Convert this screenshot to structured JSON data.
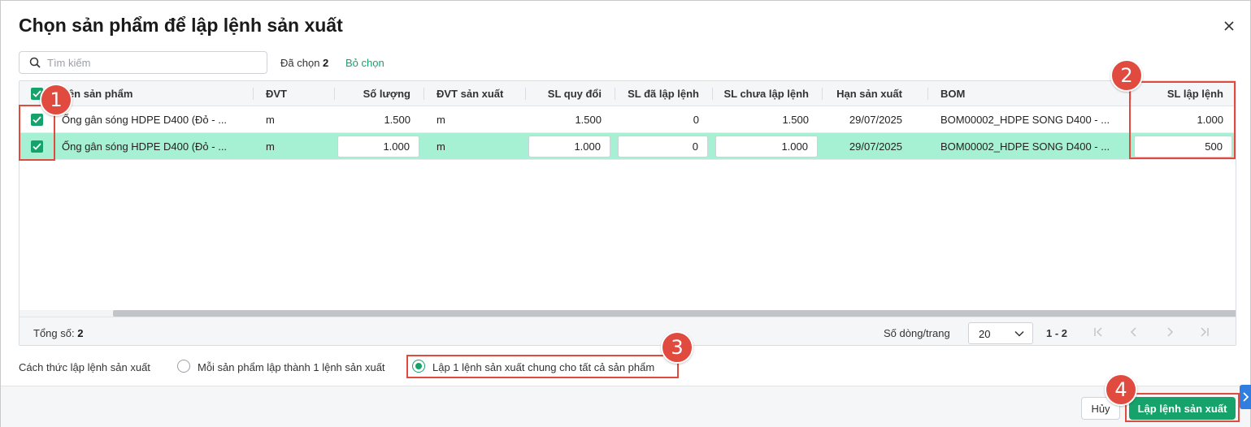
{
  "dialog": {
    "title": "Chọn sản phẩm để lập lệnh sản xuất",
    "close_icon": "close-icon"
  },
  "toolbar": {
    "search_placeholder": "Tìm kiếm",
    "selected_label": "Đã chọn",
    "selected_count": "2",
    "deselect_label": "Bỏ chọn"
  },
  "table": {
    "headers": {
      "name": "Tên sản phẩm",
      "unit": "ĐVT",
      "quantity": "Số lượng",
      "prod_unit": "ĐVT sản xuất",
      "converted": "SL quy đổi",
      "ordered": "SL đã lập lệnh",
      "not_ordered": "SL chưa lập lệnh",
      "deadline": "Hạn sản xuất",
      "bom": "BOM",
      "order_qty": "SL lập lệnh"
    },
    "rows": [
      {
        "checked": true,
        "name": "Ống gân sóng HDPE D400 (Đỏ - ...",
        "unit": "m",
        "quantity": "1.500",
        "prod_unit": "m",
        "converted": "1.500",
        "ordered": "0",
        "not_ordered": "1.500",
        "deadline": "29/07/2025",
        "bom": "BOM00002_HDPE SONG D400 - ...",
        "order_qty": "1.000"
      },
      {
        "checked": true,
        "name": "Ống gân sóng HDPE D400 (Đỏ - ...",
        "unit": "m",
        "quantity": "1.000",
        "prod_unit": "m",
        "converted": "1.000",
        "ordered": "0",
        "not_ordered": "1.000",
        "deadline": "29/07/2025",
        "bom": "BOM00002_HDPE SONG D400 - ...",
        "order_qty": "500"
      }
    ],
    "footer": {
      "total_label": "Tổng số:",
      "total_value": "2",
      "rows_per_page_label": "Số dòng/trang",
      "rows_per_page_value": "20",
      "range": "1 - 2"
    }
  },
  "mode": {
    "label": "Cách thức lập lệnh sản xuất",
    "options": [
      {
        "label": "Mỗi sản phẩm lập thành 1 lệnh sản xuất",
        "selected": false
      },
      {
        "label": "Lập 1 lệnh sản xuất chung cho tất cả sản phẩm",
        "selected": true
      }
    ]
  },
  "actions": {
    "cancel_label": "Hủy",
    "submit_label": "Lập lệnh sản xuất"
  },
  "annotations": [
    "1",
    "2",
    "3",
    "4"
  ],
  "colors": {
    "accent": "#16a36b",
    "selected_row": "#a6f1d3",
    "highlight": "#e04a3f",
    "side_tab": "#2f7ee0"
  }
}
